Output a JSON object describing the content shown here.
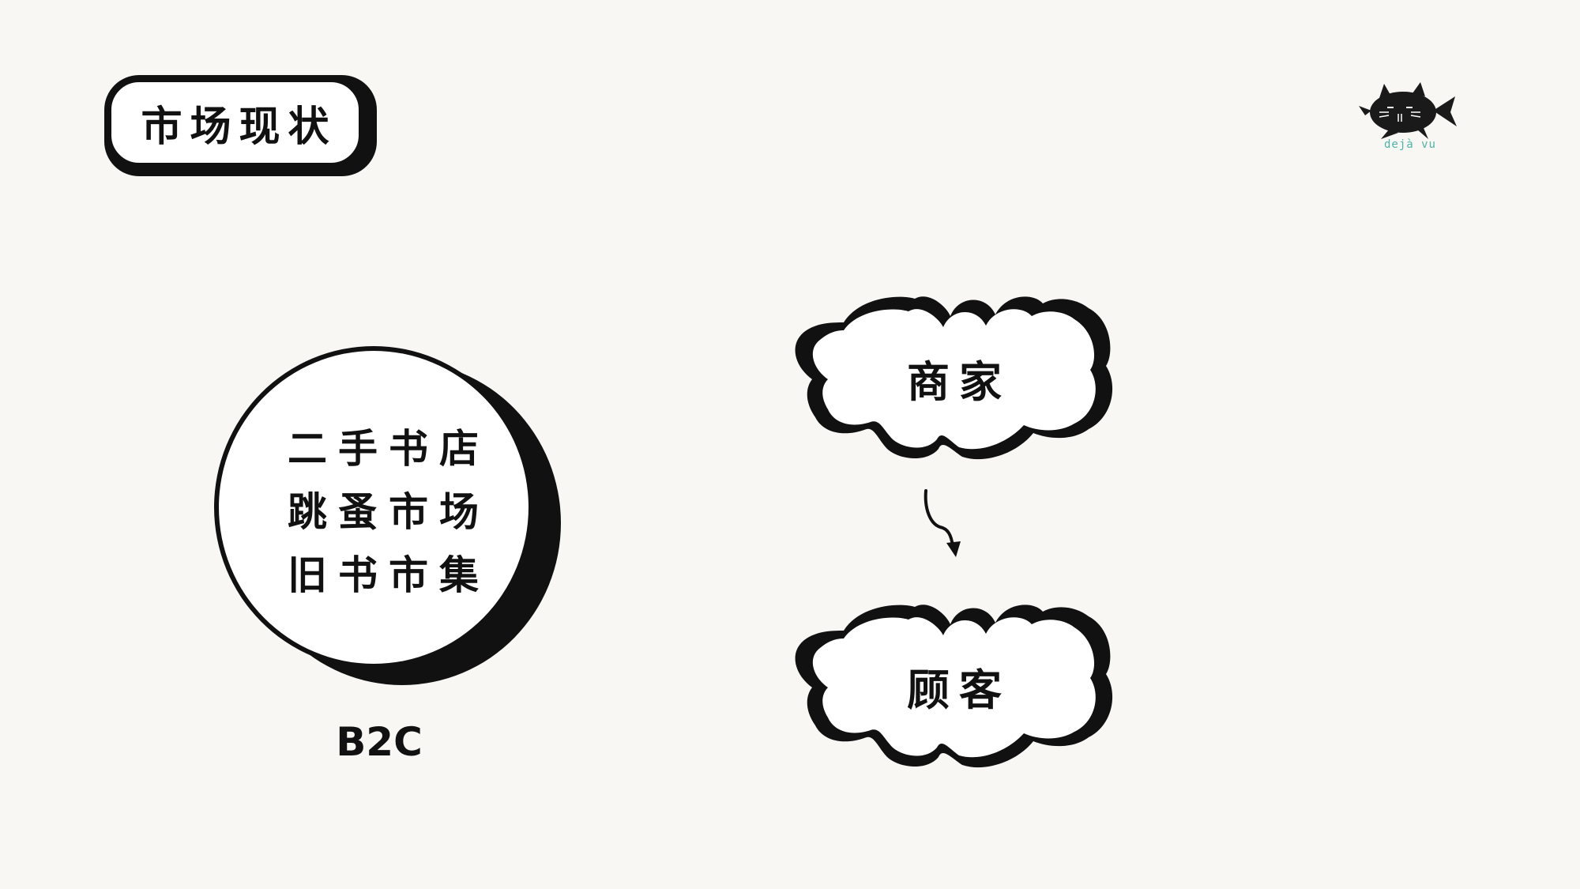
{
  "title": "市场现状",
  "logo": {
    "icon": "cat-fish-icon",
    "text": "dejà vu"
  },
  "circle": {
    "lines": [
      "二手书店",
      "跳蚤市场",
      "旧书市集"
    ],
    "caption": "B2C"
  },
  "clouds": {
    "top_label": "商家",
    "bottom_label": "顾客"
  },
  "arrow": {
    "icon": "curved-arrow-down-icon"
  },
  "colors": {
    "background": "#f8f7f3",
    "ink": "#111111",
    "fill": "#ffffff",
    "logo_accent": "#4fb3a8"
  }
}
